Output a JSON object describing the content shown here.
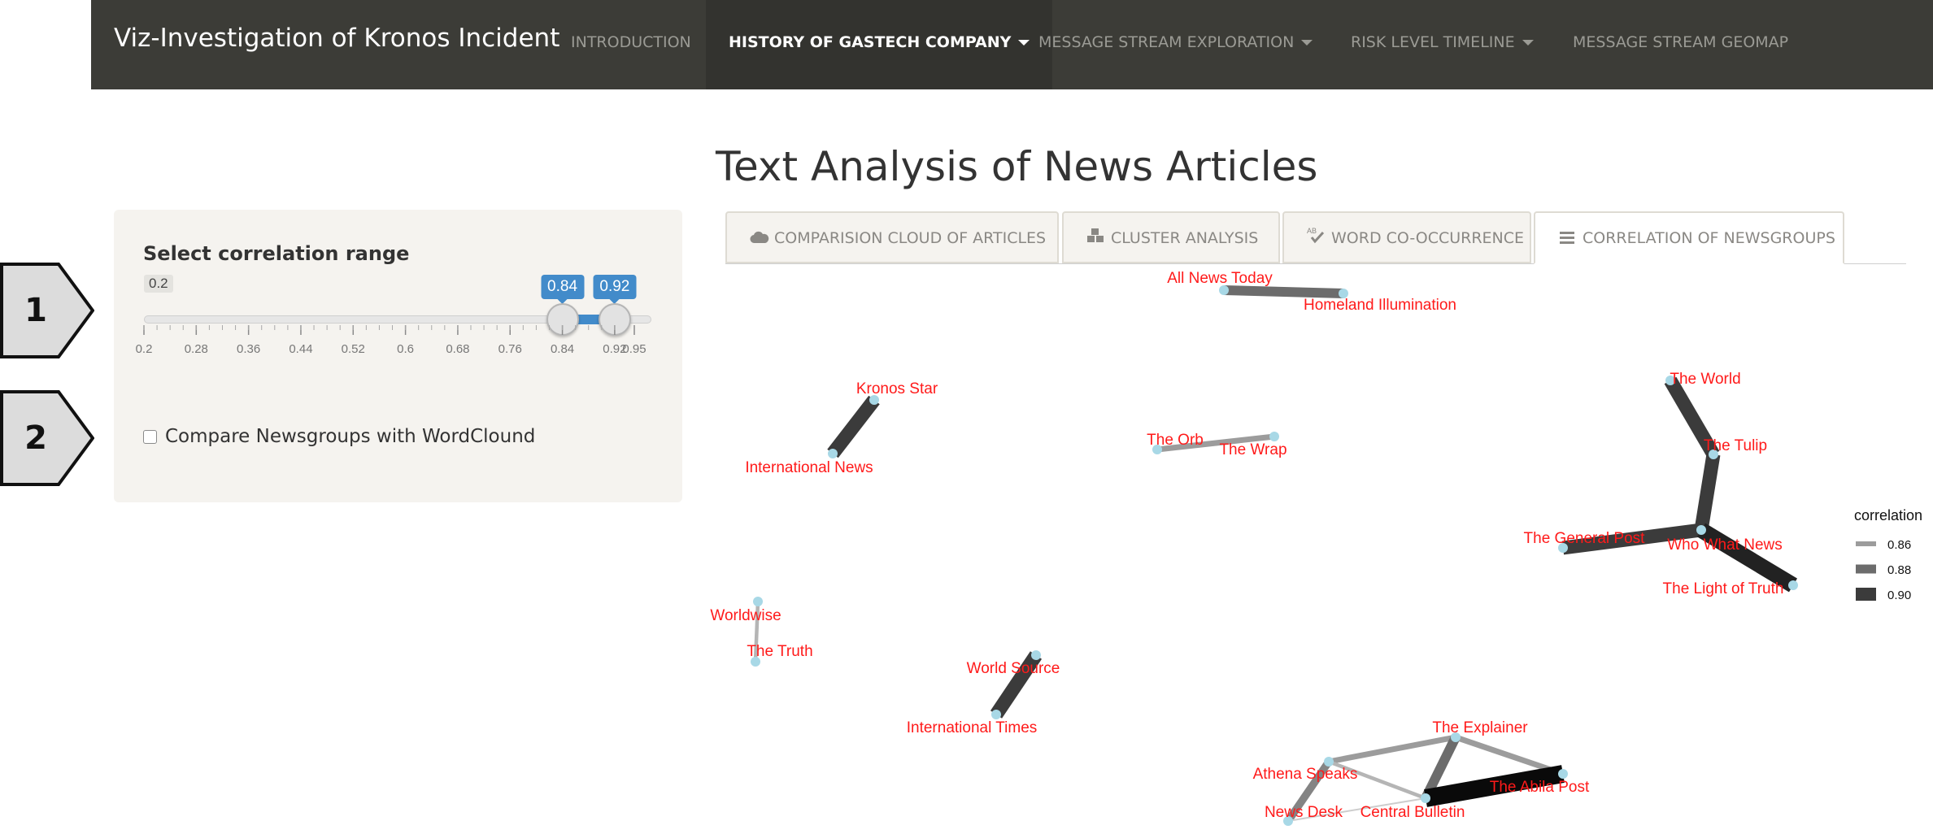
{
  "navbar": {
    "brand": "Viz-Investigation of Kronos Incident",
    "items": [
      {
        "label": "INTRODUCTION",
        "dropdown": false
      },
      {
        "label": "HISTORY OF GASTECH COMPANY",
        "dropdown": true,
        "active": true
      },
      {
        "label": "MESSAGE STREAM EXPLORATION",
        "dropdown": true
      },
      {
        "label": "RISK LEVEL TIMELINE",
        "dropdown": true
      },
      {
        "label": "MESSAGE STREAM GEOMAP",
        "dropdown": false
      }
    ]
  },
  "steps": [
    "1",
    "2"
  ],
  "sidebar": {
    "title": "Select correlation range",
    "slider": {
      "min": 0.2,
      "max": 0.95,
      "min_label": "0.2",
      "low_value": 0.84,
      "high_value": 0.92,
      "low_label": "0.84",
      "high_label": "0.92",
      "ticks": [
        "0.2",
        "0.28",
        "0.36",
        "0.44",
        "0.52",
        "0.6",
        "0.68",
        "0.76",
        "0.84",
        "0.92",
        "0.95"
      ]
    },
    "checkbox": {
      "label": "Compare Newsgroups with WordClound",
      "checked": false
    }
  },
  "main": {
    "title": "Text Analysis of News Articles",
    "tabs": [
      {
        "label": "COMPARISION CLOUD OF ARTICLES",
        "icon": "cloud-icon"
      },
      {
        "label": "CLUSTER ANALYSIS",
        "icon": "cubes-icon"
      },
      {
        "label": "WORD CO-OCCURRENCE",
        "icon": "spell-check-icon"
      },
      {
        "label": "CORRELATION OF NEWSGROUPS",
        "icon": "list-icon",
        "active": true
      }
    ]
  },
  "chart_data": {
    "type": "network",
    "nodes": [
      "All News Today",
      "Homeland Illumination",
      "Kronos Star",
      "International News",
      "The Orb",
      "The Wrap",
      "The World",
      "The Tulip",
      "Who What News",
      "The General Post",
      "The Light of Truth",
      "Worldwise",
      "The Truth",
      "World Source",
      "International Times",
      "The Explainer",
      "Athena Speaks",
      "The Abila Post",
      "News Desk",
      "Central Bulletin"
    ],
    "edges": [
      {
        "source": "All News Today",
        "target": "Homeland Illumination",
        "correlation": 0.88
      },
      {
        "source": "Kronos Star",
        "target": "International News",
        "correlation": 0.9
      },
      {
        "source": "The Orb",
        "target": "The Wrap",
        "correlation": 0.86
      },
      {
        "source": "The World",
        "target": "The Tulip",
        "correlation": 0.9
      },
      {
        "source": "The Tulip",
        "target": "Who What News",
        "correlation": 0.9
      },
      {
        "source": "Who What News",
        "target": "The General Post",
        "correlation": 0.9
      },
      {
        "source": "Who What News",
        "target": "The Light of Truth",
        "correlation": 0.91
      },
      {
        "source": "Worldwise",
        "target": "The Truth",
        "correlation": 0.85
      },
      {
        "source": "World Source",
        "target": "International Times",
        "correlation": 0.9
      },
      {
        "source": "Athena Speaks",
        "target": "The Explainer",
        "correlation": 0.86
      },
      {
        "source": "The Explainer",
        "target": "The Abila Post",
        "correlation": 0.86
      },
      {
        "source": "The Explainer",
        "target": "Central Bulletin",
        "correlation": 0.88
      },
      {
        "source": "Athena Speaks",
        "target": "Central Bulletin",
        "correlation": 0.85
      },
      {
        "source": "Athena Speaks",
        "target": "News Desk",
        "correlation": 0.87
      },
      {
        "source": "News Desk",
        "target": "Central Bulletin",
        "correlation": 0.84
      },
      {
        "source": "Central Bulletin",
        "target": "The Abila Post",
        "correlation": 0.92
      }
    ],
    "legend": {
      "title": "correlation",
      "entries": [
        {
          "label": "0.86",
          "value": 0.86
        },
        {
          "label": "0.88",
          "value": 0.88
        },
        {
          "label": "0.90",
          "value": 0.9
        }
      ],
      "position": "right"
    },
    "node_color": "#a8d8e6",
    "label_color": "#ff1a1a"
  }
}
